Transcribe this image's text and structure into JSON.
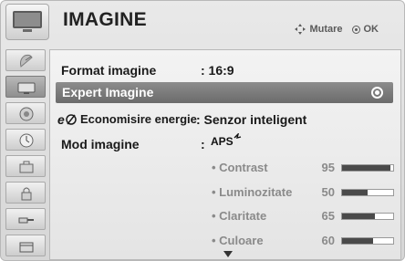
{
  "header": {
    "title": "IMAGINE",
    "help_move": "Mutare",
    "help_ok": "OK"
  },
  "side_menu": [
    {
      "icon": "satellite-dish-icon",
      "selected": false
    },
    {
      "icon": "picture-monitor-icon",
      "selected": true
    },
    {
      "icon": "speaker-icon",
      "selected": false
    },
    {
      "icon": "clock-icon",
      "selected": false
    },
    {
      "icon": "toolbox-icon",
      "selected": false
    },
    {
      "icon": "lock-icon",
      "selected": false
    },
    {
      "icon": "input-plug-icon",
      "selected": false
    },
    {
      "icon": "usb-media-icon",
      "selected": false
    }
  ],
  "menu": {
    "format_label": "Format imagine",
    "format_value": ": 16:9",
    "expert_label": "Expert Imagine",
    "energy_label": "Economisire energie",
    "energy_value": ": Senzor inteligent",
    "mode_label": "Mod imagine",
    "mode_colon": ":",
    "mode_value_logo": "APS"
  },
  "settings": [
    {
      "label": "• Contrast",
      "value": "95",
      "level": 0.95
    },
    {
      "label": "• Luminozitate",
      "value": "50",
      "level": 0.5
    },
    {
      "label": "• Claritate",
      "value": "65",
      "level": 0.65
    },
    {
      "label": "• Culoare",
      "value": "60",
      "level": 0.6
    }
  ],
  "colors": {
    "selection": "#7b7b7b",
    "bar_fill": "#4a4a4a",
    "sub_text": "#8a8a8a"
  }
}
